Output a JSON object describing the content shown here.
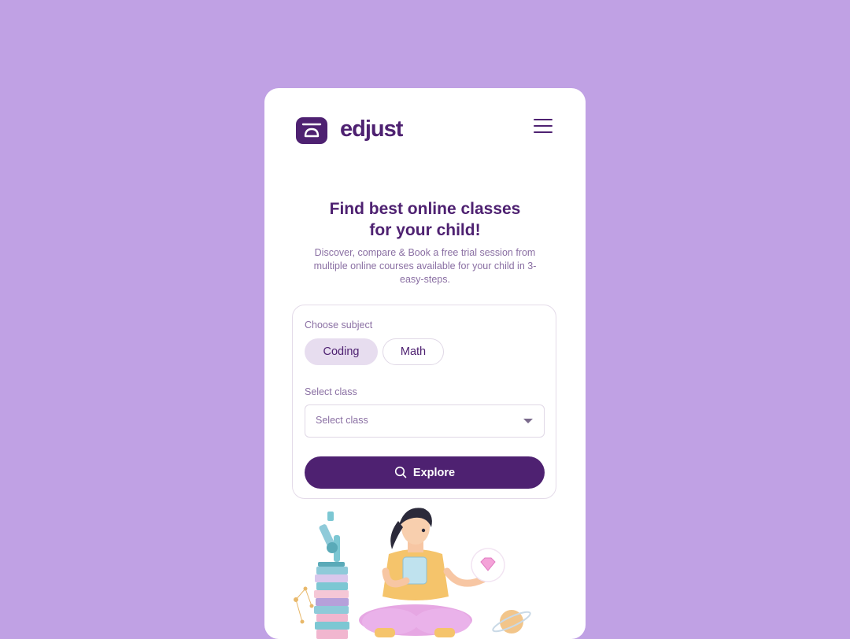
{
  "brand": {
    "name": "edjust",
    "logo_icon": "edjust-logo-mark",
    "color": "#4e2171"
  },
  "header": {
    "menu_icon": "hamburger-menu-icon"
  },
  "hero": {
    "title_line1": "Find best online classes",
    "title_line2": "for your child!",
    "subtitle_line1": "Discover, compare & Book a free trial session from",
    "subtitle_line2": "multiple online courses available for your child in 3-",
    "subtitle_line3": "easy-steps."
  },
  "form": {
    "subject_label": "Choose subject",
    "subjects": [
      {
        "label": "Coding",
        "selected": true
      },
      {
        "label": "Math",
        "selected": false
      }
    ],
    "class_label": "Select class",
    "class_select": {
      "placeholder": "Select class"
    },
    "explore_label": "Explore",
    "explore_icon": "search-icon"
  },
  "colors": {
    "background": "#c0a1e4",
    "accent": "#4e2171",
    "chip_active": "#e7ddef"
  }
}
